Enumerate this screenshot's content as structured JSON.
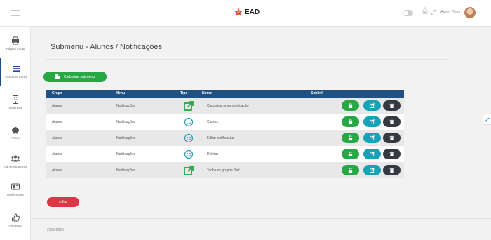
{
  "header": {
    "brand": "EAD",
    "username": "Adriel Pires"
  },
  "sidebar": {
    "items": [
      {
        "label": "Página Inicial",
        "icon": "printer-icon"
      },
      {
        "label": "Estrutura Portal",
        "icon": "menu-icon"
      },
      {
        "label": "Empresa",
        "icon": "building-icon"
      },
      {
        "label": "Planos",
        "icon": "piggy-bank-icon"
      },
      {
        "label": "Administradores",
        "icon": "users-icon"
      },
      {
        "label": "professores",
        "icon": "id-card-icon"
      },
      {
        "label": "Parcerias",
        "icon": "thumbs-up-icon"
      }
    ]
  },
  "main": {
    "title": "Submenu - Alunos / Notificações",
    "add_button": "Cadastrar submenu",
    "back_button": "voltar"
  },
  "table": {
    "headers": [
      "Grupo",
      "Menu",
      "Tipo",
      "Nome",
      "Sublink"
    ],
    "rows": [
      {
        "grupo": "Alunos",
        "menu": "Notificações",
        "tipo": "external-link-icon",
        "nome": "Cadastrar nova notificação"
      },
      {
        "grupo": "Alunos",
        "menu": "Notificações",
        "tipo": "smile-icon",
        "nome": "Cursos"
      },
      {
        "grupo": "Alunos",
        "menu": "Notificações",
        "tipo": "smile-icon",
        "nome": "Editar notificação"
      },
      {
        "grupo": "Alunos",
        "menu": "Notificações",
        "tipo": "smile-icon",
        "nome": "Deletar"
      },
      {
        "grupo": "Alunos",
        "menu": "Notificações",
        "tipo": "external-link-icon",
        "nome": "Todos os grupos Salt"
      }
    ]
  },
  "footer": {
    "text": "2016-2023"
  },
  "colors": {
    "table_header": "#1f5283",
    "success": "#28a745",
    "info": "#17a2b8",
    "dark": "#343a40",
    "danger": "#dc3545"
  }
}
